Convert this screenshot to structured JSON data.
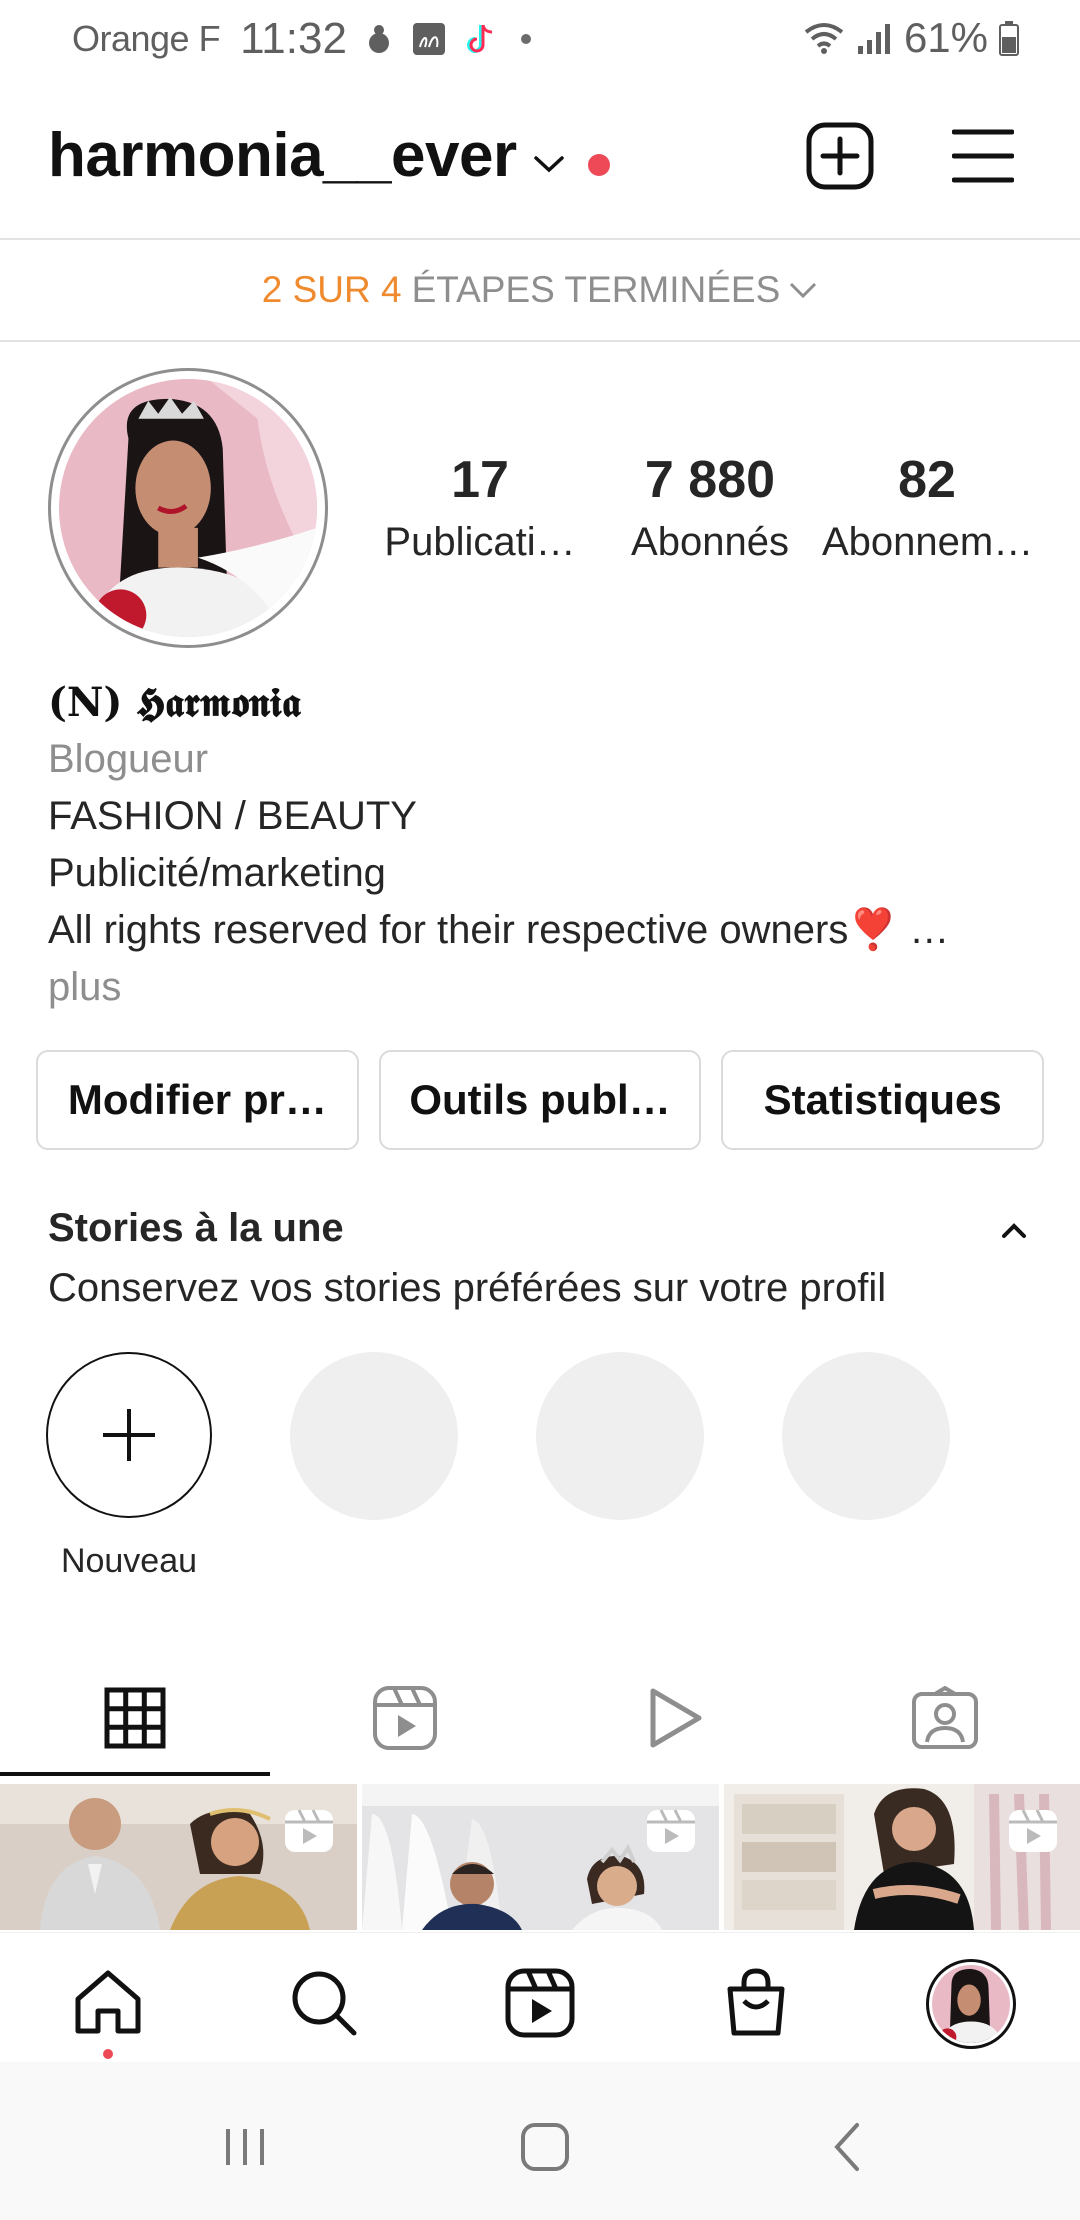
{
  "status_bar": {
    "carrier": "Orange F",
    "time": "11:32",
    "battery": "61%"
  },
  "header": {
    "username": "harmonia__ever"
  },
  "setup": {
    "progress": "2 SUR 4",
    "label": "ÉTAPES TERMINÉES"
  },
  "profile": {
    "stats": [
      {
        "value": "17",
        "label": "Publicati…"
      },
      {
        "value": "7 880",
        "label": "Abonnés"
      },
      {
        "value": "82",
        "label": "Abonnem…"
      }
    ],
    "display_name": "(N) 𝕳𝖆𝖗𝖒𝖔𝖓𝖎𝖆",
    "category": "Blogueur",
    "bio_lines": [
      "FASHION / BEAUTY",
      "Publicité/marketing",
      "All rights reserved for their respective owners❣️ …"
    ],
    "more": "plus"
  },
  "actions": {
    "edit_profile": "Modifier pr…",
    "ad_tools": "Outils publ…",
    "insights": "Statistiques"
  },
  "highlights": {
    "title": "Stories à la une",
    "subtitle": "Conservez vos stories préférées sur votre profil",
    "new_label": "Nouveau"
  },
  "tabs": [
    {
      "icon": "grid-icon",
      "active": true
    },
    {
      "icon": "reels-icon",
      "active": false
    },
    {
      "icon": "play-icon",
      "active": false
    },
    {
      "icon": "tagged-icon",
      "active": false
    }
  ],
  "grid_posts": [
    {
      "type": "reel",
      "icon": "reel-badge-icon"
    },
    {
      "type": "reel",
      "icon": "reel-badge-icon"
    },
    {
      "type": "reel",
      "icon": "reel-badge-icon"
    }
  ],
  "bottom_nav": [
    {
      "icon": "home-icon",
      "active": true
    },
    {
      "icon": "search-icon"
    },
    {
      "icon": "reels-icon"
    },
    {
      "icon": "shop-icon"
    },
    {
      "icon": "profile-avatar"
    }
  ],
  "colors": {
    "accent_orange": "#f08a2e",
    "notification_red": "#ed4956",
    "secondary_text": "#8e8e8e"
  }
}
